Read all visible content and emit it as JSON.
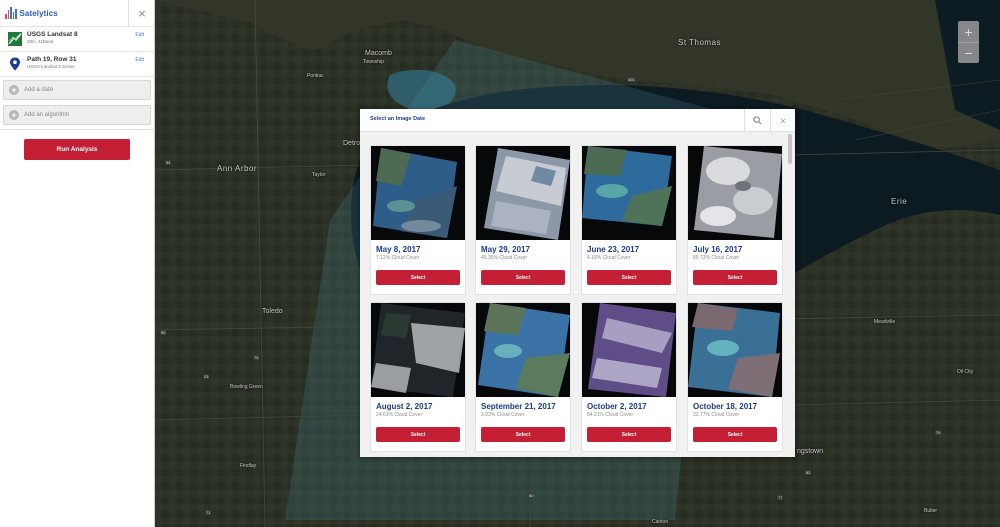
{
  "app": {
    "brand": "Satelytics"
  },
  "sidebar": {
    "close_icon": "×",
    "sensor": {
      "title": "USGS Landsat 8",
      "subtitle": "30m, 11Band",
      "edit_label": "Edit"
    },
    "location": {
      "title": "Path 19, Row 31",
      "subtitle": "USGS Landsat 8 Scene",
      "edit_label": "Edit"
    },
    "add_date_label": "Add a date",
    "add_algorithm_label": "Add an algorithm",
    "run_label": "Run Analysis"
  },
  "map": {
    "labels": {
      "macomb": "Macomb",
      "macomb_township": "Township",
      "st_thomas": "St Thomas",
      "pontiac": "Pontiac",
      "ann_arbor": "Ann Arbor",
      "detroit": "Detroit",
      "taylor": "Taylor",
      "toledo": "Toledo",
      "bowling_green": "Bowling Green",
      "findlay": "Findlay",
      "erie": "Erie",
      "meadville": "Meadville",
      "oil_city": "Oil City",
      "youngstown": "ngstown",
      "butler": "Butler",
      "canton": "Canton",
      "hwy_401": "401",
      "hwy_94": "94",
      "hwy_75": "75",
      "hwy_23": "23",
      "hwy_80": "80",
      "hwy_79": "79",
      "hwy_90": "90",
      "hwy_71": "71",
      "hwy_77": "77",
      "hwy_62": "62"
    },
    "zoom_in": "+",
    "zoom_out": "−"
  },
  "modal": {
    "title": "Select an Image Date",
    "close_icon": "×",
    "select_label": "Select",
    "images": [
      {
        "date": "May 8, 2017",
        "cloud": "7.12% Cloud Cover"
      },
      {
        "date": "May 29, 2017",
        "cloud": "45.35% Cloud Cover"
      },
      {
        "date": "June 23, 2017",
        "cloud": "4.18% Cloud Cover"
      },
      {
        "date": "July 16, 2017",
        "cloud": "89.73% Cloud Cover"
      },
      {
        "date": "August 2, 2017",
        "cloud": "24.61% Cloud Cover"
      },
      {
        "date": "September 21, 2017",
        "cloud": "2.93% Cloud Cover"
      },
      {
        "date": "October 2, 2017",
        "cloud": "54.21% Cloud Cover"
      },
      {
        "date": "October 18, 2017",
        "cloud": "32.77% Cloud Cover"
      }
    ]
  }
}
